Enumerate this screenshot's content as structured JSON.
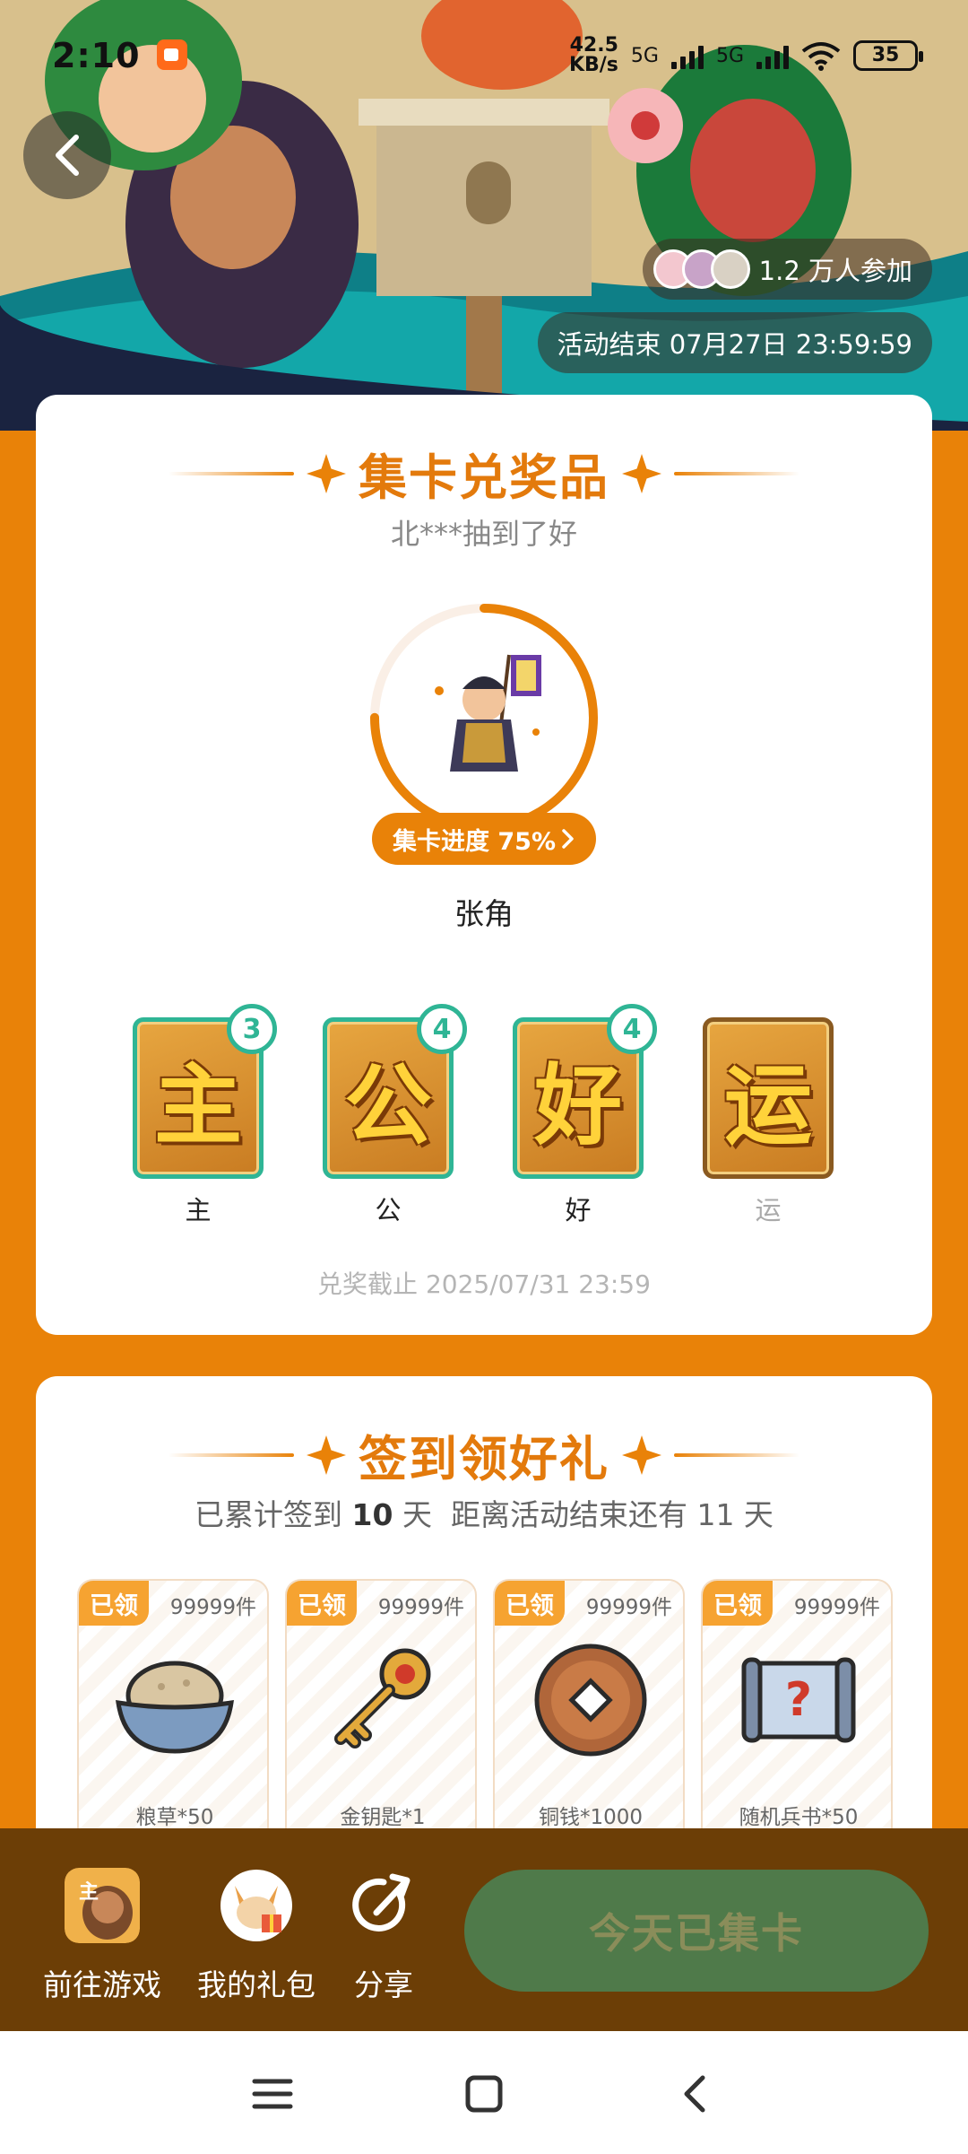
{
  "status_bar": {
    "time": "2:10",
    "speed_value": "42.5",
    "speed_unit": "KB/s",
    "network_1": "5G",
    "network_2": "5G",
    "battery": "35"
  },
  "hero": {
    "participants": "1.2 万人参加",
    "end_time": "活动结束 07月27日 23:59:59"
  },
  "collect": {
    "title": "集卡兑奖品",
    "winner_text": "北***抽到了好",
    "progress_label": "集卡进度 75%",
    "progress_value": 0.75,
    "hero_name": "张角",
    "cards": [
      {
        "glyph": "主",
        "label": "主",
        "count": "3",
        "collected": true
      },
      {
        "glyph": "公",
        "label": "公",
        "count": "4",
        "collected": true
      },
      {
        "glyph": "好",
        "label": "好",
        "count": "4",
        "collected": true
      },
      {
        "glyph": "运",
        "label": "运",
        "count": "",
        "collected": false
      }
    ],
    "deadline": "兑奖截止 2025/07/31 23:59"
  },
  "signin": {
    "title": "签到领好礼",
    "sub_prefix": "已累计签到 ",
    "days_signed": "10",
    "sub_suffix": " 天  距离活动结束还有 11 天",
    "rewards": [
      {
        "tag": "已领",
        "stock": "99999件",
        "name": "粮草*50",
        "icon": "rice-bowl-icon"
      },
      {
        "tag": "已领",
        "stock": "99999件",
        "name": "金钥匙*1",
        "icon": "golden-key-icon"
      },
      {
        "tag": "已领",
        "stock": "99999件",
        "name": "铜钱*1000",
        "icon": "copper-coin-icon"
      },
      {
        "tag": "已领",
        "stock": "99999件",
        "name": "随机兵书*50",
        "icon": "scroll-icon"
      }
    ]
  },
  "action_bar": {
    "goto_game": "前往游戏",
    "my_gifts": "我的礼包",
    "share": "分享",
    "primary": "今天已集卡"
  },
  "colors": {
    "page_bg": "#e98208",
    "accent": "#e37a0c",
    "teal": "#2fb595",
    "action_bar": "#6c3e06",
    "primary_button": "#4f7a4a"
  }
}
